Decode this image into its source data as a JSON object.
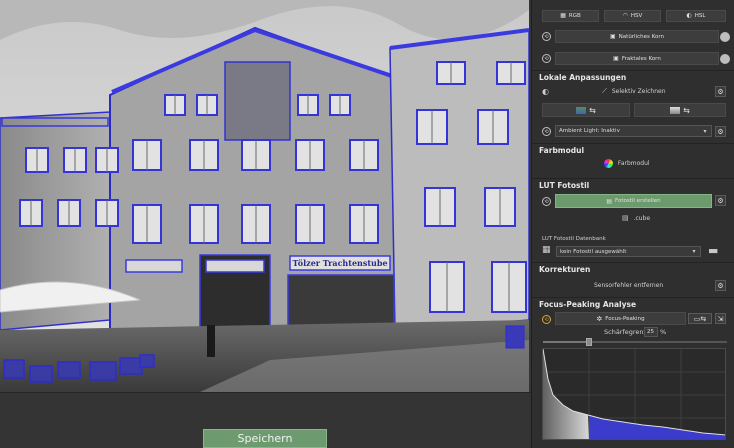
{
  "colors": {
    "accent_green": "#6e9a70",
    "focus_blue": "#4040e0",
    "panel_bg": "#2f2f2f"
  },
  "viewport": {
    "photo_alt": "Building facade with focus peaking overlay",
    "shop_signs": [
      "Tölzer Trachtenstube"
    ],
    "save_label": "Speichern"
  },
  "panel": {
    "color_modes": [
      {
        "label": "RGB",
        "icon": "rgb-icon"
      },
      {
        "label": "HSV",
        "icon": "wifi-icon"
      },
      {
        "label": "HSL",
        "icon": "hsl-icon"
      }
    ],
    "grain": [
      {
        "label": "Natürliches Korn",
        "icon": "film-icon"
      },
      {
        "label": "Fraktales Korn",
        "icon": "film-icon"
      }
    ],
    "lokale": {
      "title": "Lokale Anpassungen",
      "selective_label": "Selektiv Zeichnen",
      "ambient_value": "Ambient Light: Inaktiv"
    },
    "farbmodul": {
      "title": "Farbmodul",
      "button_label": "Farbmodul"
    },
    "lut": {
      "title": "LUT Fotostil",
      "create_label": "Fotostil erstellen",
      "cube_label": ".cube",
      "db_label": "LUT Fotostil Datenbank",
      "db_value": "kein Fotostil ausgewählt"
    },
    "korrekturen": {
      "title": "Korrekturen",
      "sensor_label": "Sensorfehler entfernen"
    },
    "focus": {
      "title": "Focus-Peaking Analyse",
      "button_label": "Focus-Peaking",
      "sharpness_label": "Schärfegrenze",
      "sharpness_value": "25",
      "sharpness_unit": "%",
      "sharpness_level": 0.25
    }
  }
}
